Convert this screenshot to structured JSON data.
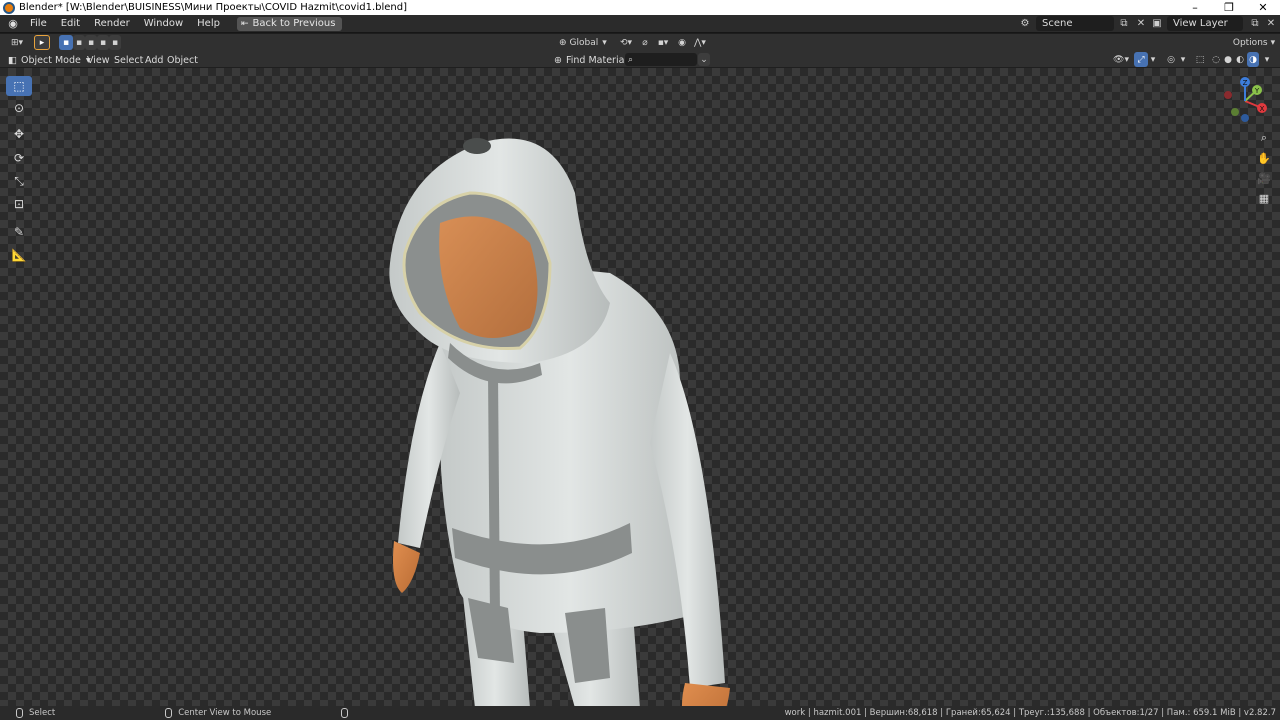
{
  "window": {
    "title": "Blender* [W:\\Blender\\BUISINESS\\Мини Проекты\\COVID Hazmit\\covid1.blend]",
    "minimize": "–",
    "maximize": "❐",
    "close": "✕"
  },
  "menu": {
    "items": [
      "File",
      "Edit",
      "Render",
      "Window",
      "Help"
    ],
    "back_button": "Back to Previous"
  },
  "scene": {
    "label": "Scene"
  },
  "view_layer": {
    "label": "View Layer"
  },
  "header": {
    "orientation": "Global",
    "options": "Options",
    "mode": "Object Mode",
    "view_menu": [
      "View",
      "Select",
      "Add",
      "Object"
    ],
    "find_materials": "Find Materials",
    "search_placeholder": ""
  },
  "viewport": {
    "object": "hazmat suit character",
    "gizmo_axes": [
      "X",
      "Y",
      "Z"
    ]
  },
  "status": {
    "select": "Select",
    "center_view": "Center View to Mouse",
    "stats": "work | hazmit.001 | Вершин:68,618 | Граней:65,624 | Треуг.:135,688 | Объектов:1/27 | Пам.: 659.1 MiB | v2.82.7"
  },
  "colors": {
    "accent": "#4772b3",
    "axis_x": "#e0393e",
    "axis_y": "#8bc34a",
    "axis_z": "#3d7ddb"
  }
}
